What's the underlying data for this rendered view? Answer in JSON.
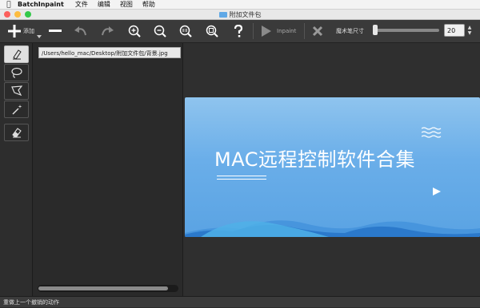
{
  "menubar": {
    "apple_icon": "apple-icon",
    "app_name": "BatchInpaint",
    "items": [
      "文件",
      "编辑",
      "视图",
      "帮助"
    ]
  },
  "window": {
    "title": "附加文件包"
  },
  "toolbar": {
    "add_label": "添加",
    "inpaint_label": "Inpaint",
    "brush_size_label": "魔术笔尺寸",
    "brush_size_value": 20,
    "brush_size_fraction": 0.0
  },
  "file_panel": {
    "path": "/Users/hello_mac/Desktop/附加文件包/背景.jpg"
  },
  "preview": {
    "headline": "MAC远程控制软件合集"
  },
  "status": {
    "text": "重做上一个撤销的动作"
  },
  "colors": {
    "accent": "#5aa3e3",
    "toolbar_bg": "#3a3a3a",
    "panel_bg": "#2a2a2a"
  }
}
